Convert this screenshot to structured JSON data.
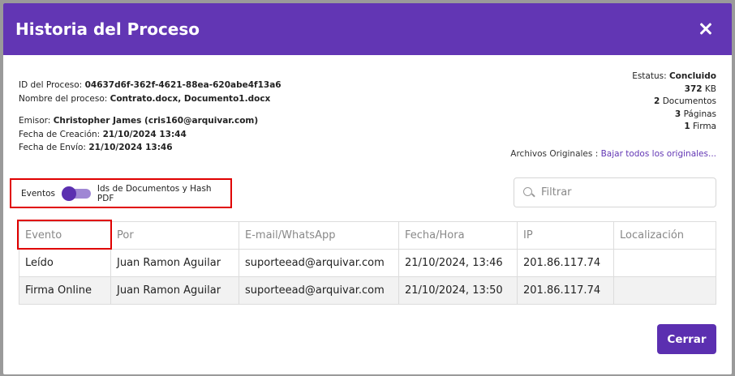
{
  "dialog": {
    "title": "Historia del Proceso"
  },
  "info": {
    "process_id_label": "ID del Proceso:",
    "process_id_value": "04637d6f-362f-4621-88ea-620abe4f13a6",
    "process_name_label": "Nombre del proceso:",
    "process_name_value": "Contrato.docx, Documento1.docx",
    "issuer_label": "Emisor:",
    "issuer_value": "Christopher James (cris160@arquivar.com)",
    "created_label": "Fecha de Creación:",
    "created_value": "21/10/2024 13:44",
    "sent_label": "Fecha de Envío:",
    "sent_value": "21/10/2024 13:46"
  },
  "summary": {
    "status_label": "Estatus:",
    "status_value": "Concluido",
    "size_value": "372",
    "size_unit": "KB",
    "docs_value": "2",
    "docs_label": "Documentos",
    "pages_value": "3",
    "pages_label": "Páginas",
    "signatures_value": "1",
    "signatures_label": "Firma"
  },
  "originals": {
    "label": "Archivos Originales :",
    "link": "Bajar todos los originales..."
  },
  "toggle": {
    "left_label": "Eventos",
    "right_label": "Ids de Documentos y Hash PDF"
  },
  "filter": {
    "placeholder": "Filtrar"
  },
  "table": {
    "headers": [
      "Evento",
      "Por",
      "E-mail/WhatsApp",
      "Fecha/Hora",
      "IP",
      "Localización"
    ],
    "rows": [
      [
        "Leído",
        "Juan Ramon Aguilar",
        "suporteead@arquivar.com",
        "21/10/2024, 13:46",
        "201.86.117.74",
        ""
      ],
      [
        "Firma Online",
        "Juan Ramon Aguilar",
        "suporteead@arquivar.com",
        "21/10/2024, 13:50",
        "201.86.117.74",
        ""
      ]
    ]
  },
  "footer": {
    "close_label": "Cerrar"
  },
  "colors": {
    "header": "#6236b4",
    "accent": "#5b2fb0",
    "highlight": "#e00000"
  },
  "icons": {
    "close": "close-icon",
    "search": "search-icon"
  }
}
